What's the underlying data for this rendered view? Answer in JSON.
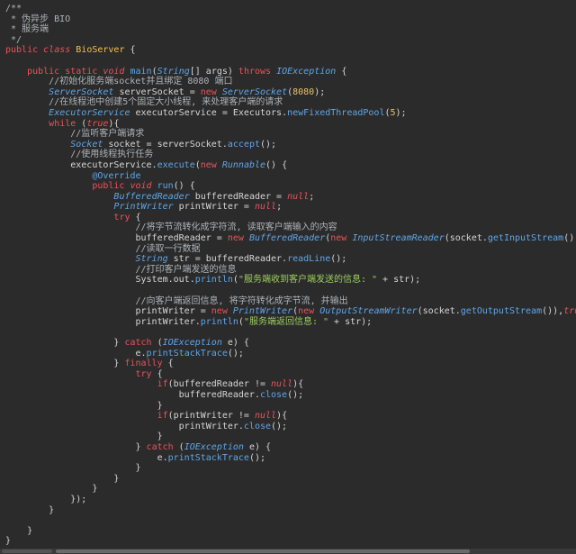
{
  "lines": [
    [
      {
        "t": "/**",
        "c": "comment"
      }
    ],
    [
      {
        "t": " * 伪异步 BIO",
        "c": "comment"
      }
    ],
    [
      {
        "t": " * 服务端",
        "c": "comment"
      }
    ],
    [
      {
        "t": " */",
        "c": "comment"
      }
    ],
    [
      {
        "t": "public ",
        "c": "keyword"
      },
      {
        "t": "class ",
        "c": "italic-kw"
      },
      {
        "t": "BioServer",
        "c": "class"
      },
      {
        "t": " {",
        "c": "plain"
      }
    ],
    [],
    [
      {
        "t": "    public static ",
        "c": "keyword"
      },
      {
        "t": "void ",
        "c": "italic-kw"
      },
      {
        "t": "main",
        "c": "method"
      },
      {
        "t": "(",
        "c": "plain"
      },
      {
        "t": "String",
        "c": "type"
      },
      {
        "t": "[] args) ",
        "c": "plain"
      },
      {
        "t": "throws ",
        "c": "keyword"
      },
      {
        "t": "IOException",
        "c": "type"
      },
      {
        "t": " {",
        "c": "plain"
      }
    ],
    [
      {
        "t": "        //初始化服务端socket并且绑定 8080 端口",
        "c": "comment"
      }
    ],
    [
      {
        "t": "        ",
        "c": "plain"
      },
      {
        "t": "ServerSocket",
        "c": "type"
      },
      {
        "t": " serverSocket = ",
        "c": "plain"
      },
      {
        "t": "new ",
        "c": "keyword"
      },
      {
        "t": "ServerSocket",
        "c": "type"
      },
      {
        "t": "(",
        "c": "plain"
      },
      {
        "t": "8080",
        "c": "number"
      },
      {
        "t": ");",
        "c": "plain"
      }
    ],
    [
      {
        "t": "        //在线程池中创建5个固定大小线程, 来处理客户端的请求",
        "c": "comment"
      }
    ],
    [
      {
        "t": "        ",
        "c": "plain"
      },
      {
        "t": "ExecutorService",
        "c": "type"
      },
      {
        "t": " executorService = Executors.",
        "c": "plain"
      },
      {
        "t": "newFixedThreadPool",
        "c": "method"
      },
      {
        "t": "(",
        "c": "plain"
      },
      {
        "t": "5",
        "c": "number"
      },
      {
        "t": ");",
        "c": "plain"
      }
    ],
    [
      {
        "t": "        ",
        "c": "plain"
      },
      {
        "t": "while ",
        "c": "keyword"
      },
      {
        "t": "(",
        "c": "plain"
      },
      {
        "t": "true",
        "c": "italic-kw"
      },
      {
        "t": "){",
        "c": "plain"
      }
    ],
    [
      {
        "t": "            //监听客户端请求",
        "c": "comment"
      }
    ],
    [
      {
        "t": "            ",
        "c": "plain"
      },
      {
        "t": "Socket",
        "c": "type"
      },
      {
        "t": " socket = serverSocket.",
        "c": "plain"
      },
      {
        "t": "accept",
        "c": "method"
      },
      {
        "t": "();",
        "c": "plain"
      }
    ],
    [
      {
        "t": "            //使用线程执行任务",
        "c": "comment"
      }
    ],
    [
      {
        "t": "            executorService.",
        "c": "plain"
      },
      {
        "t": "execute",
        "c": "method"
      },
      {
        "t": "(",
        "c": "plain"
      },
      {
        "t": "new ",
        "c": "keyword"
      },
      {
        "t": "Runnable",
        "c": "type"
      },
      {
        "t": "() {",
        "c": "plain"
      }
    ],
    [
      {
        "t": "                ",
        "c": "plain"
      },
      {
        "t": "@Override",
        "c": "annotation"
      }
    ],
    [
      {
        "t": "                ",
        "c": "plain"
      },
      {
        "t": "public ",
        "c": "keyword"
      },
      {
        "t": "void ",
        "c": "italic-kw"
      },
      {
        "t": "run",
        "c": "method"
      },
      {
        "t": "() {",
        "c": "plain"
      }
    ],
    [
      {
        "t": "                    ",
        "c": "plain"
      },
      {
        "t": "BufferedReader",
        "c": "type"
      },
      {
        "t": " bufferedReader = ",
        "c": "plain"
      },
      {
        "t": "null",
        "c": "italic-kw"
      },
      {
        "t": ";",
        "c": "plain"
      }
    ],
    [
      {
        "t": "                    ",
        "c": "plain"
      },
      {
        "t": "PrintWriter",
        "c": "type"
      },
      {
        "t": " printWriter = ",
        "c": "plain"
      },
      {
        "t": "null",
        "c": "italic-kw"
      },
      {
        "t": ";",
        "c": "plain"
      }
    ],
    [
      {
        "t": "                    ",
        "c": "plain"
      },
      {
        "t": "try ",
        "c": "keyword"
      },
      {
        "t": "{",
        "c": "plain"
      }
    ],
    [
      {
        "t": "                        //将字节流转化成字符流, 读取客户端输入的内容",
        "c": "comment"
      }
    ],
    [
      {
        "t": "                        bufferedReader = ",
        "c": "plain"
      },
      {
        "t": "new ",
        "c": "keyword"
      },
      {
        "t": "BufferedReader",
        "c": "type"
      },
      {
        "t": "(",
        "c": "plain"
      },
      {
        "t": "new ",
        "c": "keyword"
      },
      {
        "t": "InputStreamReader",
        "c": "type"
      },
      {
        "t": "(socket.",
        "c": "plain"
      },
      {
        "t": "getInputStream",
        "c": "method"
      },
      {
        "t": "()));",
        "c": "plain"
      }
    ],
    [
      {
        "t": "                        //读取一行数据",
        "c": "comment"
      }
    ],
    [
      {
        "t": "                        ",
        "c": "plain"
      },
      {
        "t": "String",
        "c": "type"
      },
      {
        "t": " str = bufferedReader.",
        "c": "plain"
      },
      {
        "t": "readLine",
        "c": "method"
      },
      {
        "t": "();",
        "c": "plain"
      }
    ],
    [
      {
        "t": "                        //打印客户端发送的信息",
        "c": "comment"
      }
    ],
    [
      {
        "t": "                        System.",
        "c": "plain"
      },
      {
        "t": "out",
        "c": "plain"
      },
      {
        "t": ".",
        "c": "plain"
      },
      {
        "t": "println",
        "c": "method"
      },
      {
        "t": "(",
        "c": "plain"
      },
      {
        "t": "\"服务端收到客户端发送的信息: \"",
        "c": "string"
      },
      {
        "t": " + str);",
        "c": "plain"
      }
    ],
    [],
    [
      {
        "t": "                        //向客户端返回信息, 将字符转化成字节流, 并输出",
        "c": "comment"
      }
    ],
    [
      {
        "t": "                        printWriter = ",
        "c": "plain"
      },
      {
        "t": "new ",
        "c": "keyword"
      },
      {
        "t": "PrintWriter",
        "c": "type"
      },
      {
        "t": "(",
        "c": "plain"
      },
      {
        "t": "new ",
        "c": "keyword"
      },
      {
        "t": "OutputStreamWriter",
        "c": "type"
      },
      {
        "t": "(socket.",
        "c": "plain"
      },
      {
        "t": "getOutputStream",
        "c": "method"
      },
      {
        "t": "()),",
        "c": "plain"
      },
      {
        "t": "true",
        "c": "italic-kw"
      },
      {
        "t": ");",
        "c": "plain"
      }
    ],
    [
      {
        "t": "                        printWriter.",
        "c": "plain"
      },
      {
        "t": "println",
        "c": "method"
      },
      {
        "t": "(",
        "c": "plain"
      },
      {
        "t": "\"服务端返回信息: \"",
        "c": "string"
      },
      {
        "t": " + str);",
        "c": "plain"
      }
    ],
    [],
    [
      {
        "t": "                    } ",
        "c": "plain"
      },
      {
        "t": "catch ",
        "c": "keyword"
      },
      {
        "t": "(",
        "c": "plain"
      },
      {
        "t": "IOException",
        "c": "type"
      },
      {
        "t": " e) {",
        "c": "plain"
      }
    ],
    [
      {
        "t": "                        e.",
        "c": "plain"
      },
      {
        "t": "printStackTrace",
        "c": "method"
      },
      {
        "t": "();",
        "c": "plain"
      }
    ],
    [
      {
        "t": "                    } ",
        "c": "plain"
      },
      {
        "t": "finally ",
        "c": "keyword"
      },
      {
        "t": "{",
        "c": "plain"
      }
    ],
    [
      {
        "t": "                        ",
        "c": "plain"
      },
      {
        "t": "try ",
        "c": "keyword"
      },
      {
        "t": "{",
        "c": "plain"
      }
    ],
    [
      {
        "t": "                            ",
        "c": "plain"
      },
      {
        "t": "if",
        "c": "keyword"
      },
      {
        "t": "(bufferedReader != ",
        "c": "plain"
      },
      {
        "t": "null",
        "c": "italic-kw"
      },
      {
        "t": "){",
        "c": "plain"
      }
    ],
    [
      {
        "t": "                                bufferedReader.",
        "c": "plain"
      },
      {
        "t": "close",
        "c": "method"
      },
      {
        "t": "();",
        "c": "plain"
      }
    ],
    [
      {
        "t": "                            }",
        "c": "plain"
      }
    ],
    [
      {
        "t": "                            ",
        "c": "plain"
      },
      {
        "t": "if",
        "c": "keyword"
      },
      {
        "t": "(printWriter != ",
        "c": "plain"
      },
      {
        "t": "null",
        "c": "italic-kw"
      },
      {
        "t": "){",
        "c": "plain"
      }
    ],
    [
      {
        "t": "                                printWriter.",
        "c": "plain"
      },
      {
        "t": "close",
        "c": "method"
      },
      {
        "t": "();",
        "c": "plain"
      }
    ],
    [
      {
        "t": "                            }",
        "c": "plain"
      }
    ],
    [
      {
        "t": "                        } ",
        "c": "plain"
      },
      {
        "t": "catch ",
        "c": "keyword"
      },
      {
        "t": "(",
        "c": "plain"
      },
      {
        "t": "IOException",
        "c": "type"
      },
      {
        "t": " e) {",
        "c": "plain"
      }
    ],
    [
      {
        "t": "                            e.",
        "c": "plain"
      },
      {
        "t": "printStackTrace",
        "c": "method"
      },
      {
        "t": "();",
        "c": "plain"
      }
    ],
    [
      {
        "t": "                        }",
        "c": "plain"
      }
    ],
    [
      {
        "t": "                    }",
        "c": "plain"
      }
    ],
    [
      {
        "t": "                }",
        "c": "plain"
      }
    ],
    [
      {
        "t": "            });",
        "c": "plain"
      }
    ],
    [
      {
        "t": "        }",
        "c": "plain"
      }
    ],
    [],
    [
      {
        "t": "    }",
        "c": "plain"
      }
    ],
    [
      {
        "t": "}",
        "c": "plain"
      }
    ]
  ]
}
